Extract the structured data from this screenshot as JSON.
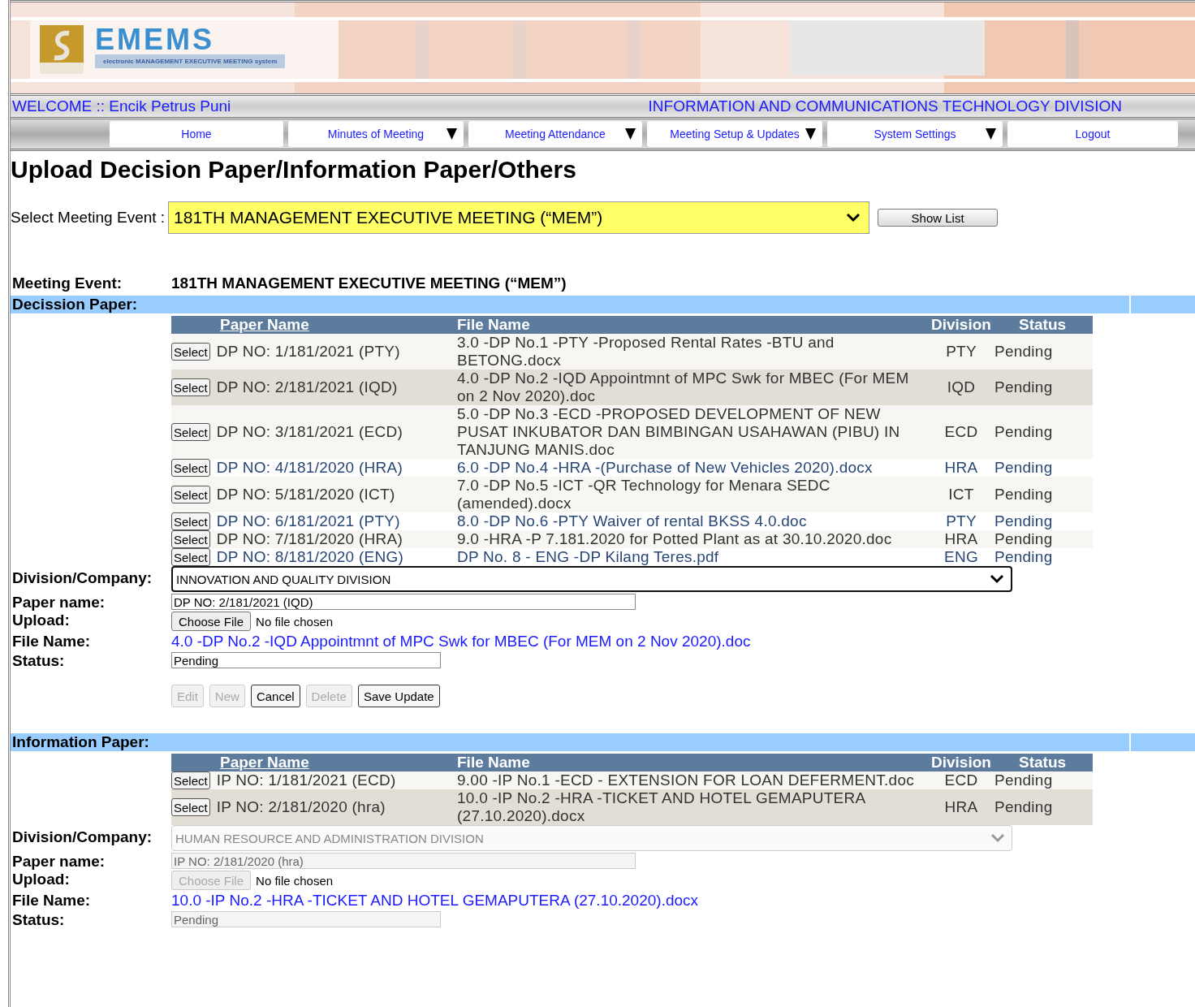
{
  "header": {
    "logo_text": "EMEMS",
    "tagline": "electronic MANAGEMENT EXECUTIVE MEETING system",
    "welcome": "WELCOME :: Encik Petrus Puni",
    "division": "INFORMATION AND COMMUNICATIONS TECHNOLOGY DIVISION"
  },
  "nav": [
    {
      "label": "Home",
      "has_submenu": false
    },
    {
      "label": "Minutes of Meeting",
      "has_submenu": true
    },
    {
      "label": "Meeting Attendance",
      "has_submenu": true
    },
    {
      "label": "Meeting Setup & Updates",
      "has_submenu": true
    },
    {
      "label": "System Settings",
      "has_submenu": true
    },
    {
      "label": "Logout",
      "has_submenu": false
    }
  ],
  "page_title": "Upload Decision Paper/Information Paper/Others",
  "meeting_select": {
    "label": "Select Meeting Event :",
    "value": "181TH MANAGEMENT EXECUTIVE MEETING (“MEM”)",
    "button": "Show List"
  },
  "meeting_event": {
    "label": "Meeting Event:",
    "value": "181TH MANAGEMENT EXECUTIVE MEETING (“MEM”)"
  },
  "sections": [
    {
      "title": "Decission Paper:",
      "columns": [
        "Paper Name",
        "File Name",
        "Division",
        "Status"
      ],
      "rows": [
        {
          "button": "Select",
          "paper_name": "DP NO: 1/181/2021 (PTY)",
          "file_name": "3.0 -DP No.1 -PTY -Proposed Rental Rates -BTU and BETONG.docx",
          "division": "PTY",
          "status": "Pending",
          "selected": false
        },
        {
          "button": "Select",
          "paper_name": "DP NO: 2/181/2021 (IQD)",
          "file_name": "4.0 -DP No.2 -IQD Appointmnt of MPC Swk for MBEC (For MEM on 2 Nov 2020).doc",
          "division": "IQD",
          "status": "Pending",
          "selected": true
        },
        {
          "button": "Select",
          "paper_name": "DP NO: 3/181/2021 (ECD)",
          "file_name": "5.0 -DP No.3 -ECD -PROPOSED DEVELOPMENT OF NEW PUSAT INKUBATOR DAN BIMBINGAN USAHAWAN (PIBU) IN TANJUNG MANIS.doc",
          "division": "ECD",
          "status": "Pending",
          "selected": false
        },
        {
          "button": "Select",
          "paper_name": "DP NO: 4/181/2020 (HRA)",
          "file_name": "6.0 -DP No.4 -HRA -(Purchase of New Vehicles 2020).docx",
          "division": "HRA",
          "status": "Pending",
          "selected": false
        },
        {
          "button": "Select",
          "paper_name": "DP NO: 5/181/2020 (ICT)",
          "file_name": "7.0 -DP No.5 -ICT -QR Technology for Menara SEDC (amended).docx",
          "division": "ICT",
          "status": "Pending",
          "selected": false
        },
        {
          "button": "Select",
          "paper_name": "DP NO: 6/181/2021 (PTY)",
          "file_name": "8.0 -DP No.6 -PTY Waiver of rental BKSS 4.0.doc",
          "division": "PTY",
          "status": "Pending",
          "selected": false
        },
        {
          "button": "Select",
          "paper_name": "DP NO: 7/181/2020 (HRA)",
          "file_name": "9.0 -HRA -P 7.181.2020 for Potted Plant as at 30.10.2020.doc",
          "division": "HRA",
          "status": "Pending",
          "selected": false
        },
        {
          "button": "Select",
          "paper_name": "DP NO: 8/181/2020 (ENG)",
          "file_name": "DP No. 8 - ENG -DP Kilang Teres.pdf",
          "division": "ENG",
          "status": "Pending",
          "selected": false
        }
      ],
      "form": {
        "disabled": false,
        "division_label": "Division/Company:",
        "division": "INNOVATION AND QUALITY DIVISION",
        "paper_label": "Paper name:",
        "paper_name": "DP NO: 2/181/2021 (IQD)",
        "upload_label": "Upload:",
        "choose_file": "Choose File",
        "no_file": "No file chosen",
        "file_label": "File Name:",
        "file_link": "4.0 -DP No.2 -IQD Appointmnt of MPC Swk for MBEC (For MEM on 2 Nov 2020).doc",
        "status_label": "Status:",
        "status": "Pending",
        "actions": [
          {
            "label": "Edit",
            "disabled": true
          },
          {
            "label": "New",
            "disabled": true
          },
          {
            "label": "Cancel",
            "disabled": false
          },
          {
            "label": "Delete",
            "disabled": true
          },
          {
            "label": "Save Update",
            "disabled": false
          }
        ]
      }
    },
    {
      "title": "Information Paper:",
      "columns": [
        "Paper Name",
        "File Name",
        "Division",
        "Status"
      ],
      "rows": [
        {
          "button": "Select",
          "paper_name": "IP NO: 1/181/2021 (ECD)",
          "file_name": "9.00 -IP No.1 -ECD - EXTENSION FOR LOAN DEFERMENT.doc",
          "division": "ECD",
          "status": "Pending",
          "selected": false
        },
        {
          "button": "Select",
          "paper_name": "IP NO: 2/181/2020 (hra)",
          "file_name": "10.0 -IP No.2 -HRA -TICKET AND HOTEL GEMAPUTERA (27.10.2020).docx",
          "division": "HRA",
          "status": "Pending",
          "selected": true
        }
      ],
      "form": {
        "disabled": true,
        "division_label": "Division/Company:",
        "division": "HUMAN RESOURCE AND ADMINISTRATION DIVISION",
        "paper_label": "Paper name:",
        "paper_name": "IP NO: 2/181/2020 (hra)",
        "upload_label": "Upload:",
        "choose_file": "Choose File",
        "no_file": "No file chosen",
        "file_label": "File Name:",
        "file_link": "10.0 -IP No.2 -HRA -TICKET AND HOTEL GEMAPUTERA (27.10.2020).docx",
        "status_label": "Status:",
        "status": "Pending"
      }
    }
  ]
}
